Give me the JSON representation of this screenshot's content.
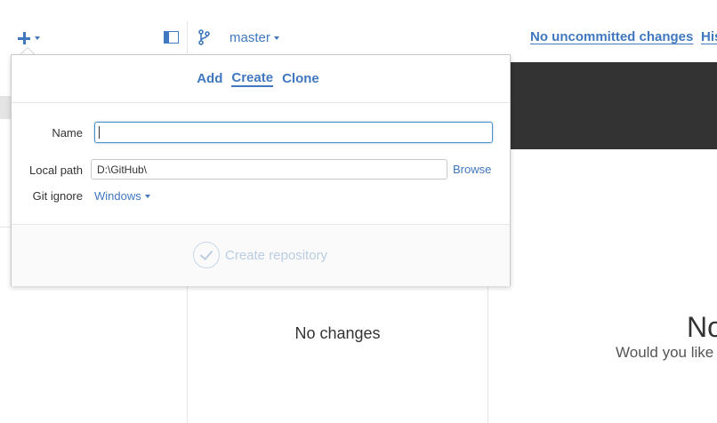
{
  "toolbar": {
    "branch": "master",
    "uncommitted_label": "No uncommitted changes",
    "history_label": "His"
  },
  "popover": {
    "tabs": [
      {
        "label": "Add",
        "active": false
      },
      {
        "label": "Create",
        "active": true
      },
      {
        "label": "Clone",
        "active": false
      }
    ],
    "form": {
      "name_label": "Name",
      "name_value": "",
      "path_label": "Local path",
      "path_value": "D:\\GitHub\\",
      "browse_label": "Browse",
      "gitignore_label": "Git ignore",
      "gitignore_value": "Windows"
    },
    "submit_label": "Create repository"
  },
  "main": {
    "changes_empty": "No changes",
    "right_heading": "No",
    "right_prompt": "Would you like"
  },
  "colors": {
    "accent": "#4078c0",
    "dark_band": "#333333",
    "disabled": "#bccde2"
  },
  "icons": {
    "add": "plus-icon",
    "sidebar": "sidebar-toggle-icon",
    "branch": "branch-icon",
    "check": "check-circle-icon"
  }
}
